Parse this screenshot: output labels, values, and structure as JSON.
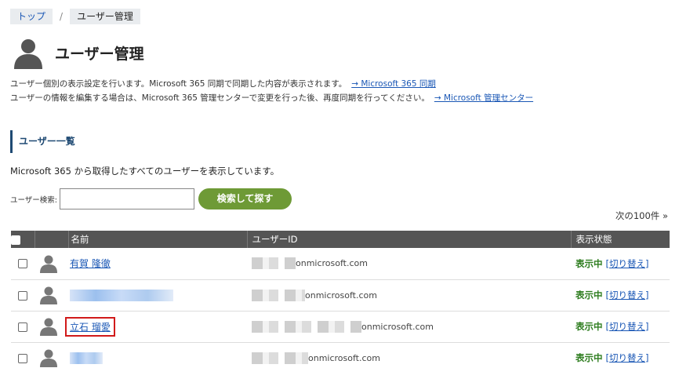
{
  "breadcrumb": {
    "home": "トップ",
    "sep": "/",
    "current": "ユーザー管理"
  },
  "page": {
    "title": "ユーザー管理"
  },
  "desc": {
    "line1": "ユーザー個別の表示設定を行います。Microsoft 365 同期で同期した内容が表示されます。",
    "link1": "→ Microsoft 365 同期",
    "line2": "ユーザーの情報を編集する場合は、Microsoft 365 管理センターで変更を行った後、再度同期を行ってください。",
    "link2": "→ Microsoft 管理センター"
  },
  "section": {
    "title": "ユーザー一覧"
  },
  "intro": "Microsoft 365 から取得したすべてのユーザーを表示しています。",
  "search": {
    "label": "ユーザー検索:",
    "value": "",
    "button": "検索して探す"
  },
  "pager": {
    "next": "次の100件 »"
  },
  "table": {
    "headers": {
      "name": "名前",
      "id": "ユーザーID",
      "status": "表示状態"
    },
    "rows": [
      {
        "name": "有賀 隆徹",
        "id_suffix": "onmicrosoft.com",
        "status": "表示中",
        "toggle": "[切り替え]"
      },
      {
        "name": "",
        "id_suffix": "onmicrosoft.com",
        "status": "表示中",
        "toggle": "[切り替え]"
      },
      {
        "name": "立石 瑠愛",
        "id_suffix": "onmicrosoft.com",
        "status": "表示中",
        "toggle": "[切り替え]"
      },
      {
        "name": "",
        "id_suffix": "onmicrosoft.com",
        "status": "表示中",
        "toggle": "[切り替え]"
      }
    ]
  },
  "colors": {
    "accent_green": "#6e9a36",
    "link": "#1a57b5",
    "header_bg": "#555555",
    "highlight": "#d11a1a"
  }
}
